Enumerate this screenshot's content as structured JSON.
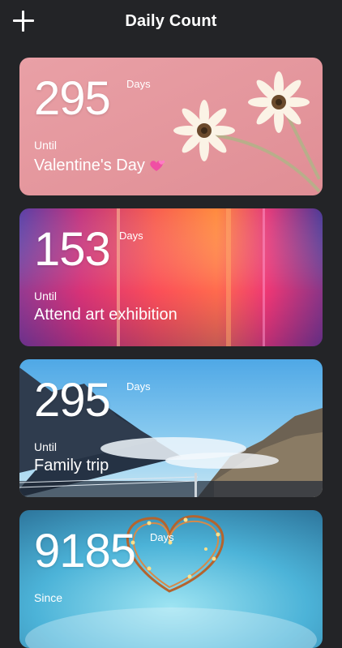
{
  "header": {
    "title": "Daily Count",
    "add_icon": "plus-icon"
  },
  "cards": [
    {
      "count": "295",
      "unit": "Days",
      "relation": "Until",
      "event": "Valentine's Day",
      "emoji_icon": "two-hearts-icon",
      "theme": "pink-daisies"
    },
    {
      "count": "153",
      "unit": "Days",
      "relation": "Until",
      "event": "Attend art exhibition",
      "theme": "gradient-streaks"
    },
    {
      "count": "295",
      "unit": "Days",
      "relation": "Until",
      "event": "Family trip",
      "theme": "mountain-lake"
    },
    {
      "count": "9185",
      "unit": "Days",
      "relation": "Since",
      "event": "",
      "theme": "heart-lights"
    }
  ],
  "colors": {
    "background": "#232427",
    "text": "#ffffff",
    "card1": "#e7999f",
    "card2": "#f2466e",
    "card3": "#5eaee6",
    "card4": "#4fb4d8"
  }
}
